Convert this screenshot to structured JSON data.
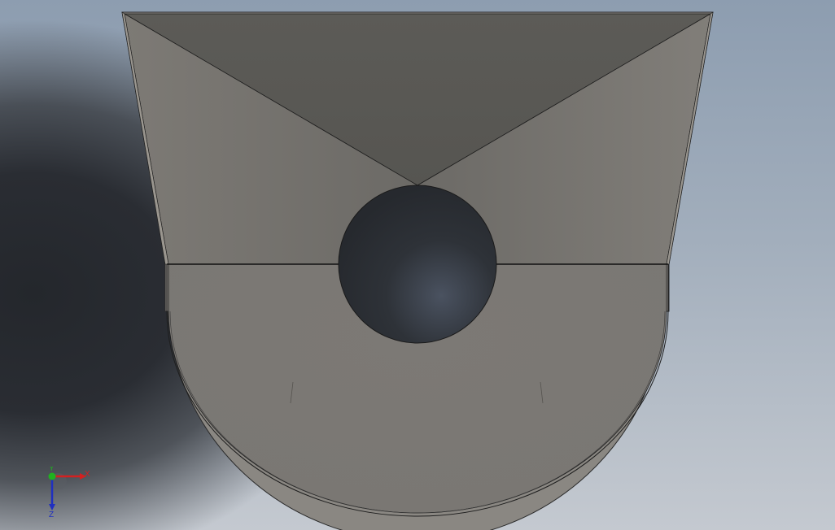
{
  "viewport": {
    "background_top": "#8d9db0",
    "background_bottom": "#c4c9d0",
    "background_dark": "#24272c"
  },
  "model": {
    "face_dark": "#5a5a56",
    "face_light": "#7e7b76",
    "face_mid": "#6d6b67",
    "hole_color": "#2c3036",
    "edge_color": "#1a1a1a"
  },
  "triad": {
    "x_label": "X",
    "y_label": "Y",
    "z_label": "Z",
    "x_color": "#d42020",
    "y_color": "#20b020",
    "z_color": "#2030c0"
  }
}
